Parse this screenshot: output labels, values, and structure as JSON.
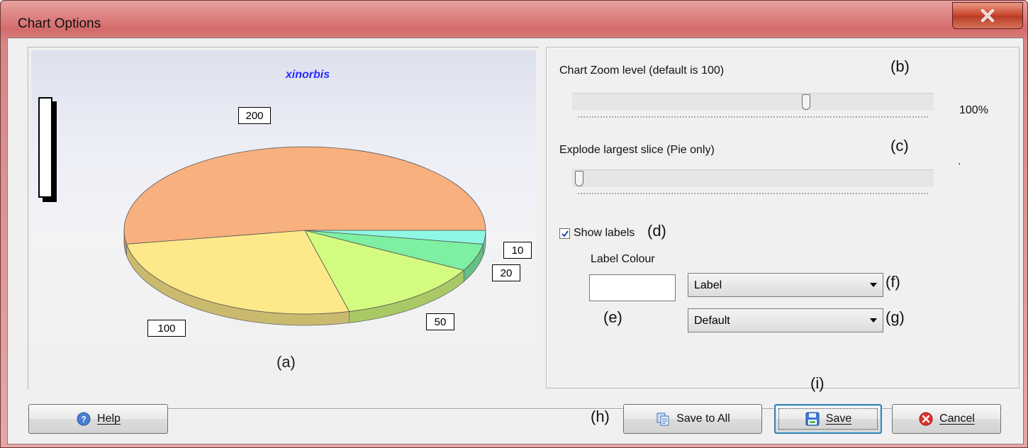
{
  "window": {
    "title": "Chart Options"
  },
  "chart": {
    "title": "xinorbis",
    "caption": "(a)"
  },
  "chart_data": {
    "type": "pie",
    "title": "xinorbis",
    "categories": [
      "200",
      "100",
      "50",
      "20",
      "10"
    ],
    "values": [
      200,
      100,
      50,
      20,
      10
    ],
    "colors": [
      "#f8b07e",
      "#fde98a",
      "#d3fb7f",
      "#7df0a3",
      "#8ef8e4"
    ],
    "data_labels": [
      "200",
      "100",
      "50",
      "20",
      "10"
    ],
    "three_d": true,
    "legend": "left"
  },
  "settings": {
    "zoom": {
      "label": "Chart Zoom level (default is 100)",
      "marker": "(b)",
      "value_text": "100%",
      "level": 0.65
    },
    "explode": {
      "label": "Explode largest slice (Pie only)",
      "marker": "(c)",
      "value_text": ".",
      "level": 0.0
    },
    "show_labels": {
      "label": "Show labels",
      "marker": "(d)",
      "checked": true
    },
    "label_colour": {
      "label": "Label Colour",
      "marker": "(e)",
      "color": "#ffffff"
    },
    "label_type": {
      "value": "Label",
      "marker": "(f)"
    },
    "label_style": {
      "value": "Default",
      "marker": "(g)"
    }
  },
  "buttons": {
    "help": "Help",
    "save_all_marker": "(h)",
    "save_all": "Save to All",
    "save_marker": "(i)",
    "save": "Save",
    "cancel": "Cancel"
  }
}
